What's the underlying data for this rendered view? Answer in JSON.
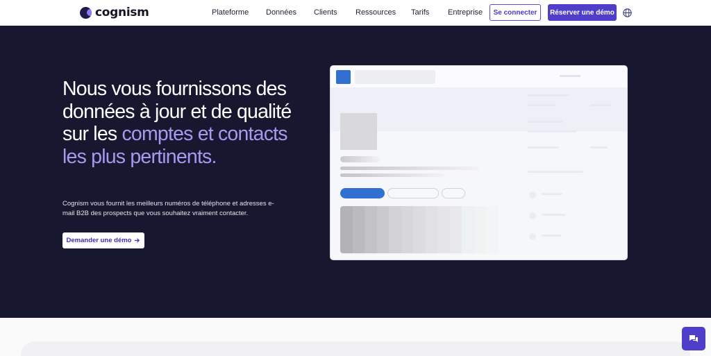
{
  "brand": {
    "name": "cognism"
  },
  "nav": {
    "items": [
      {
        "label": "Plateforme"
      },
      {
        "label": "Données"
      },
      {
        "label": "Clients"
      },
      {
        "label": "Ressources"
      },
      {
        "label": "Tarifs"
      },
      {
        "label": "Entreprise"
      }
    ],
    "login_label": "Se connecter",
    "demo_label": "Réserver une démo",
    "language_icon": "globe-icon"
  },
  "hero": {
    "title_part1": "Nous vous fournissons des données à jour et de qualité sur les ",
    "title_highlight": "comptes et contacts les plus pertinents.",
    "subtitle": "Cognism vous fournit les meilleurs numéros de téléphone et adresses e-mail B2B des prospects que vous souhaitez vraiment contacter.",
    "cta_label": "Demander une démo",
    "cta_icon": "arrow-right-icon"
  },
  "colors": {
    "hero_bg": "#17172f",
    "accent": "#4f3ec9",
    "highlight": "#a49bf0",
    "mock_blue": "#3170d1"
  },
  "chat": {
    "icon": "chat-bubbles-icon"
  }
}
